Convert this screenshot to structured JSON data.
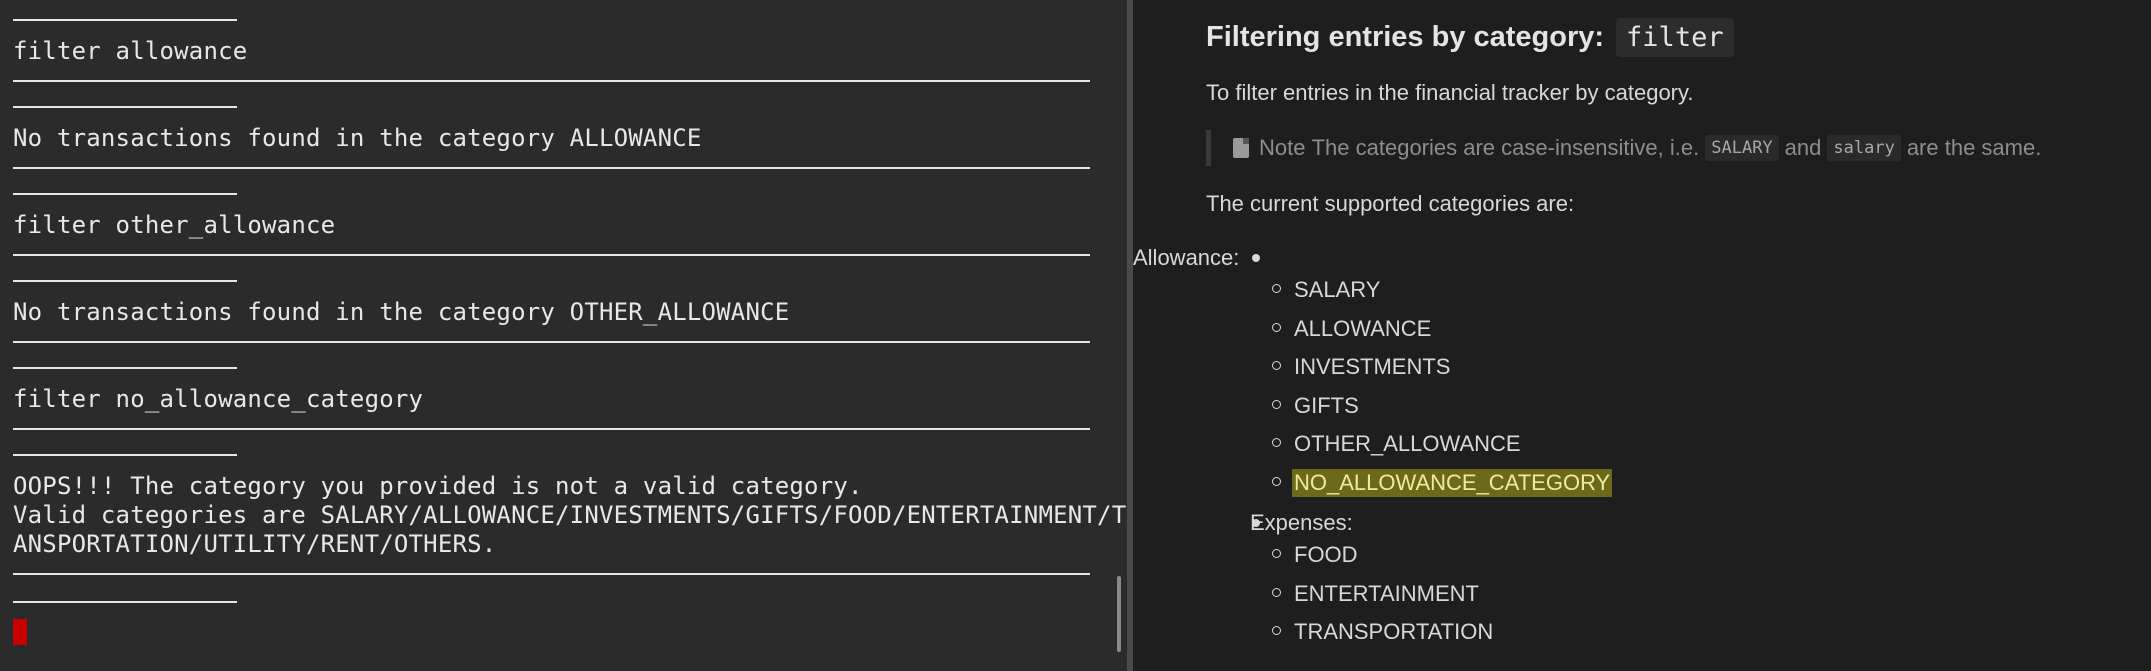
{
  "terminal": {
    "lines": {
      "cmd1": "filter allowance",
      "out1": "No transactions found in the category ALLOWANCE",
      "cmd2": "filter other_allowance",
      "out2": "No transactions found in the category OTHER_ALLOWANCE",
      "cmd3": "filter no_allowance_category",
      "err1": "OOPS!!! The category you provided is not a valid category.",
      "err2": "Valid categories are SALARY/ALLOWANCE/INVESTMENTS/GIFTS/FOOD/ENTERTAINMENT/TR",
      "err3": "ANSPORTATION/UTILITY/RENT/OTHERS."
    }
  },
  "preview": {
    "heading_text": "Filtering entries by category:",
    "heading_code": "filter",
    "intro": "To filter entries in the financial tracker by category.",
    "note": {
      "label": "Note",
      "text_before": "The categories are case-insensitive, i.e.",
      "code1": "SALARY",
      "middle": "and",
      "code2": "salary",
      "text_after": "are the same."
    },
    "supported": "The current supported categories are:",
    "groups": [
      {
        "label": "Allowance:",
        "items": [
          "SALARY",
          "ALLOWANCE",
          "INVESTMENTS",
          "GIFTS",
          "OTHER_ALLOWANCE",
          "NO_ALLOWANCE_CATEGORY"
        ]
      },
      {
        "label": "Expenses:",
        "items": [
          "FOOD",
          "ENTERTAINMENT",
          "TRANSPORTATION"
        ]
      }
    ],
    "highlight_color": "#6b6a1b"
  }
}
